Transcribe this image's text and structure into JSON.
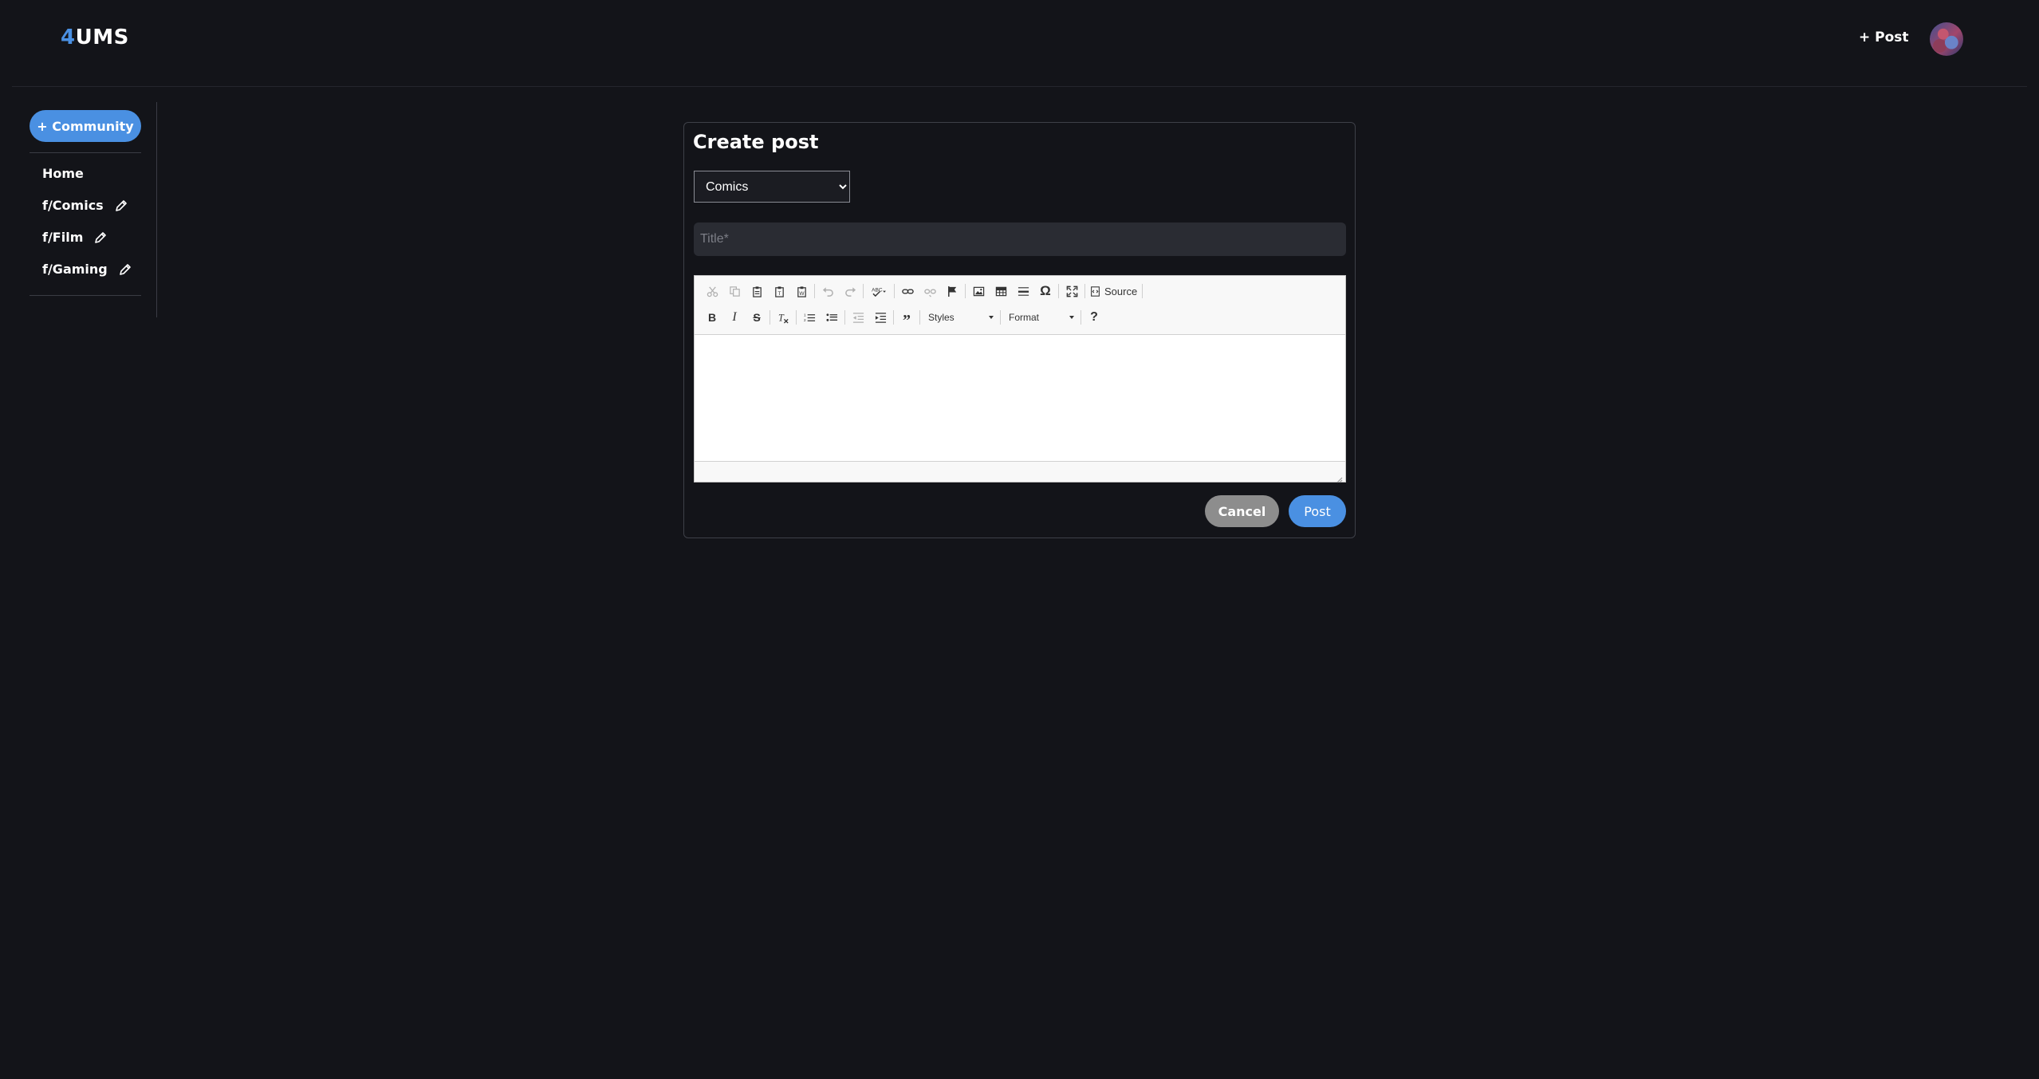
{
  "header": {
    "logo_accent": "4",
    "logo_rest": "UMS",
    "post_label": "+ Post",
    "avatar_icon": "user-avatar"
  },
  "sidebar": {
    "community_button": "+ Community",
    "home": "Home",
    "items": [
      {
        "label": "f/Comics"
      },
      {
        "label": "f/Film"
      },
      {
        "label": "f/Gaming"
      }
    ]
  },
  "form": {
    "title": "Create post",
    "community_selected": "Comics",
    "title_placeholder": "Title*",
    "title_value": "",
    "body_value": "",
    "cancel_label": "Cancel",
    "post_label": "Post"
  },
  "editor": {
    "source_label": "Source",
    "styles_label": "Styles",
    "format_label": "Format",
    "help_label": "?"
  },
  "colors": {
    "background": "#131419",
    "accent": "#4a90e2",
    "cancel": "#8d8d8d",
    "input_bg": "#2a2c33"
  }
}
